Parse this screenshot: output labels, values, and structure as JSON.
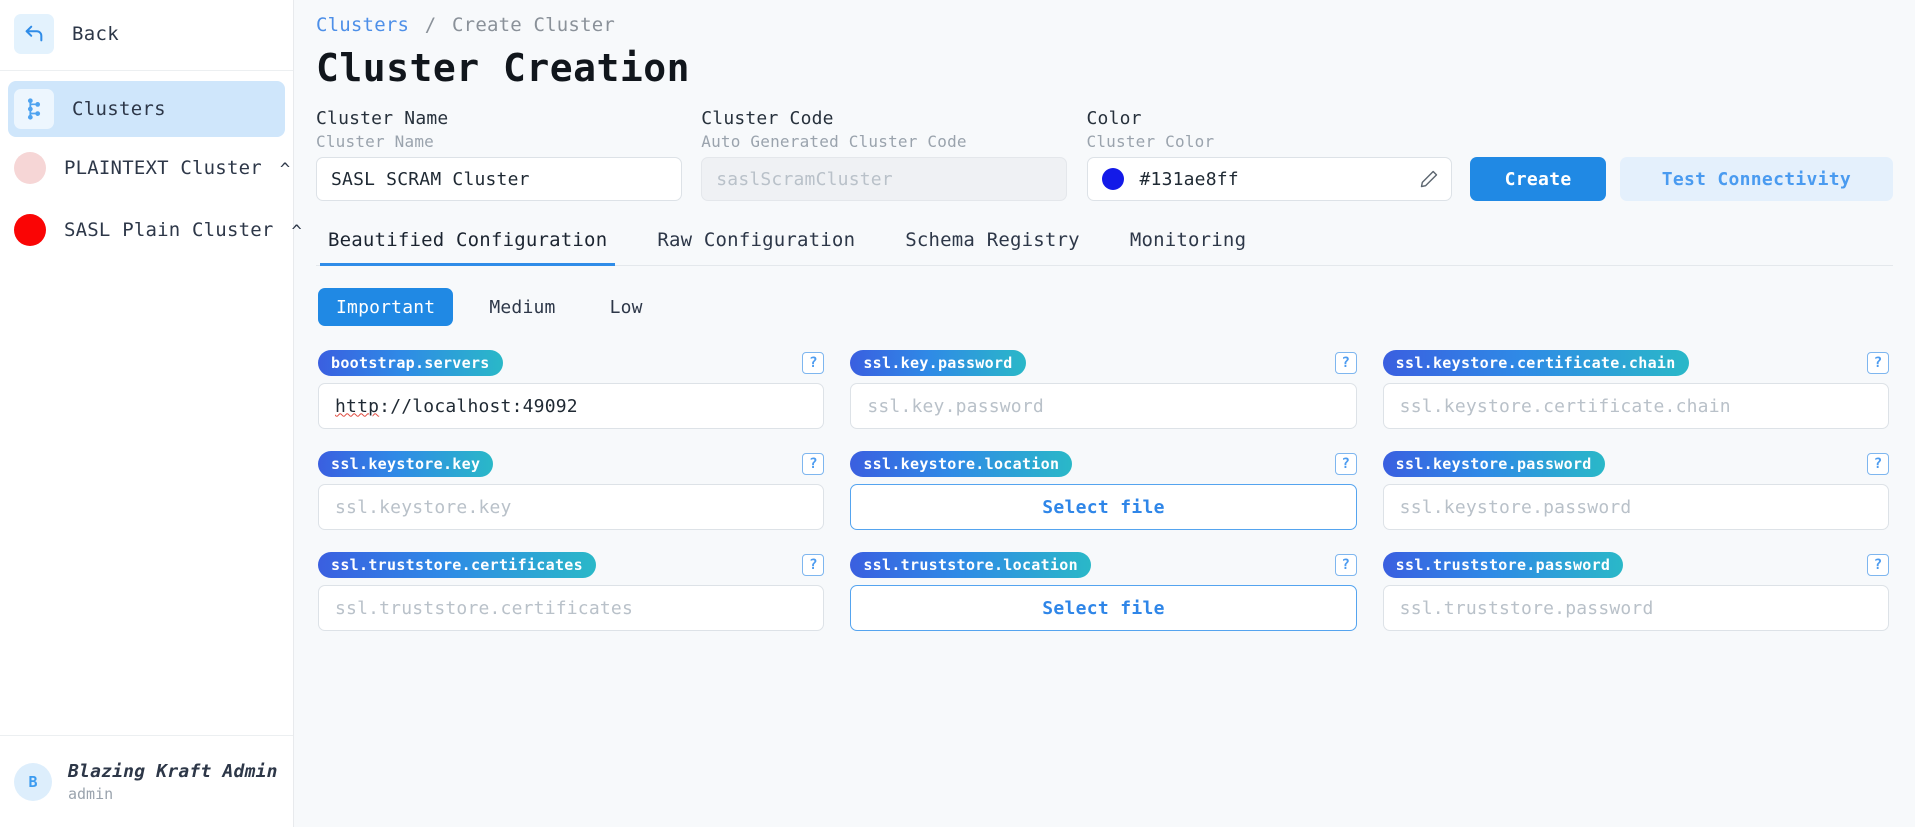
{
  "sidebar": {
    "back": {
      "label": "Back",
      "icon": "back-arrow-icon"
    },
    "nav": [
      {
        "label": "Clusters",
        "icon": "kafka-cluster-icon",
        "active": true
      }
    ],
    "clusters": [
      {
        "label": "PLAINTEXT Cluster",
        "color": "#f6d6d6",
        "chevron": "^"
      },
      {
        "label": "SASL Plain Cluster",
        "color": "#fa0505",
        "chevron": "^"
      }
    ],
    "user": {
      "initial": "B",
      "name": "Blazing Kraft Admin",
      "role": "admin"
    }
  },
  "breadcrumb": {
    "root": "Clusters",
    "separator": "/",
    "current": "Create Cluster"
  },
  "page_title": "Cluster Creation",
  "form": {
    "cluster_name": {
      "title": "Cluster Name",
      "subtitle": "Cluster Name",
      "value": "SASL SCRAM Cluster",
      "placeholder": "Cluster Name"
    },
    "cluster_code": {
      "title": "Cluster Code",
      "subtitle": "Auto Generated Cluster Code",
      "value": "",
      "placeholder": "saslScramCluster"
    },
    "color": {
      "title": "Color",
      "subtitle": "Cluster Color",
      "value": "#131ae8ff",
      "swatch": "#131ae8",
      "edit_icon": "pencil-icon"
    },
    "create_button": "Create",
    "test_button": "Test Connectivity"
  },
  "tabs": [
    {
      "label": "Beautified Configuration",
      "active": true
    },
    {
      "label": "Raw Configuration",
      "active": false
    },
    {
      "label": "Schema Registry",
      "active": false
    },
    {
      "label": "Monitoring",
      "active": false
    }
  ],
  "levels": [
    {
      "label": "Important",
      "active": true
    },
    {
      "label": "Medium",
      "active": false
    },
    {
      "label": "Low",
      "active": false
    }
  ],
  "help_glyph": "?",
  "configs": [
    {
      "key": "bootstrap.servers",
      "type": "text",
      "value": "http://localhost:49092",
      "placeholder": "bootstrap.servers",
      "spellcheck_word": "http"
    },
    {
      "key": "ssl.key.password",
      "type": "text",
      "value": "",
      "placeholder": "ssl.key.password"
    },
    {
      "key": "ssl.keystore.certificate.chain",
      "type": "text",
      "value": "",
      "placeholder": "ssl.keystore.certificate.chain"
    },
    {
      "key": "ssl.keystore.key",
      "type": "text",
      "value": "",
      "placeholder": "ssl.keystore.key"
    },
    {
      "key": "ssl.keystore.location",
      "type": "file",
      "button_label": "Select file"
    },
    {
      "key": "ssl.keystore.password",
      "type": "text",
      "value": "",
      "placeholder": "ssl.keystore.password"
    },
    {
      "key": "ssl.truststore.certificates",
      "type": "text",
      "value": "",
      "placeholder": "ssl.truststore.certificates"
    },
    {
      "key": "ssl.truststore.location",
      "type": "file",
      "button_label": "Select file"
    },
    {
      "key": "ssl.truststore.password",
      "type": "text",
      "value": "",
      "placeholder": "ssl.truststore.password"
    }
  ],
  "colors": {
    "accent": "#2089e4",
    "accent_soft": "#e4f0fc",
    "chip_gradient_start": "#3a5fe0",
    "chip_gradient_end": "#2ab8c8",
    "main_bg": "#f7f9fb"
  }
}
